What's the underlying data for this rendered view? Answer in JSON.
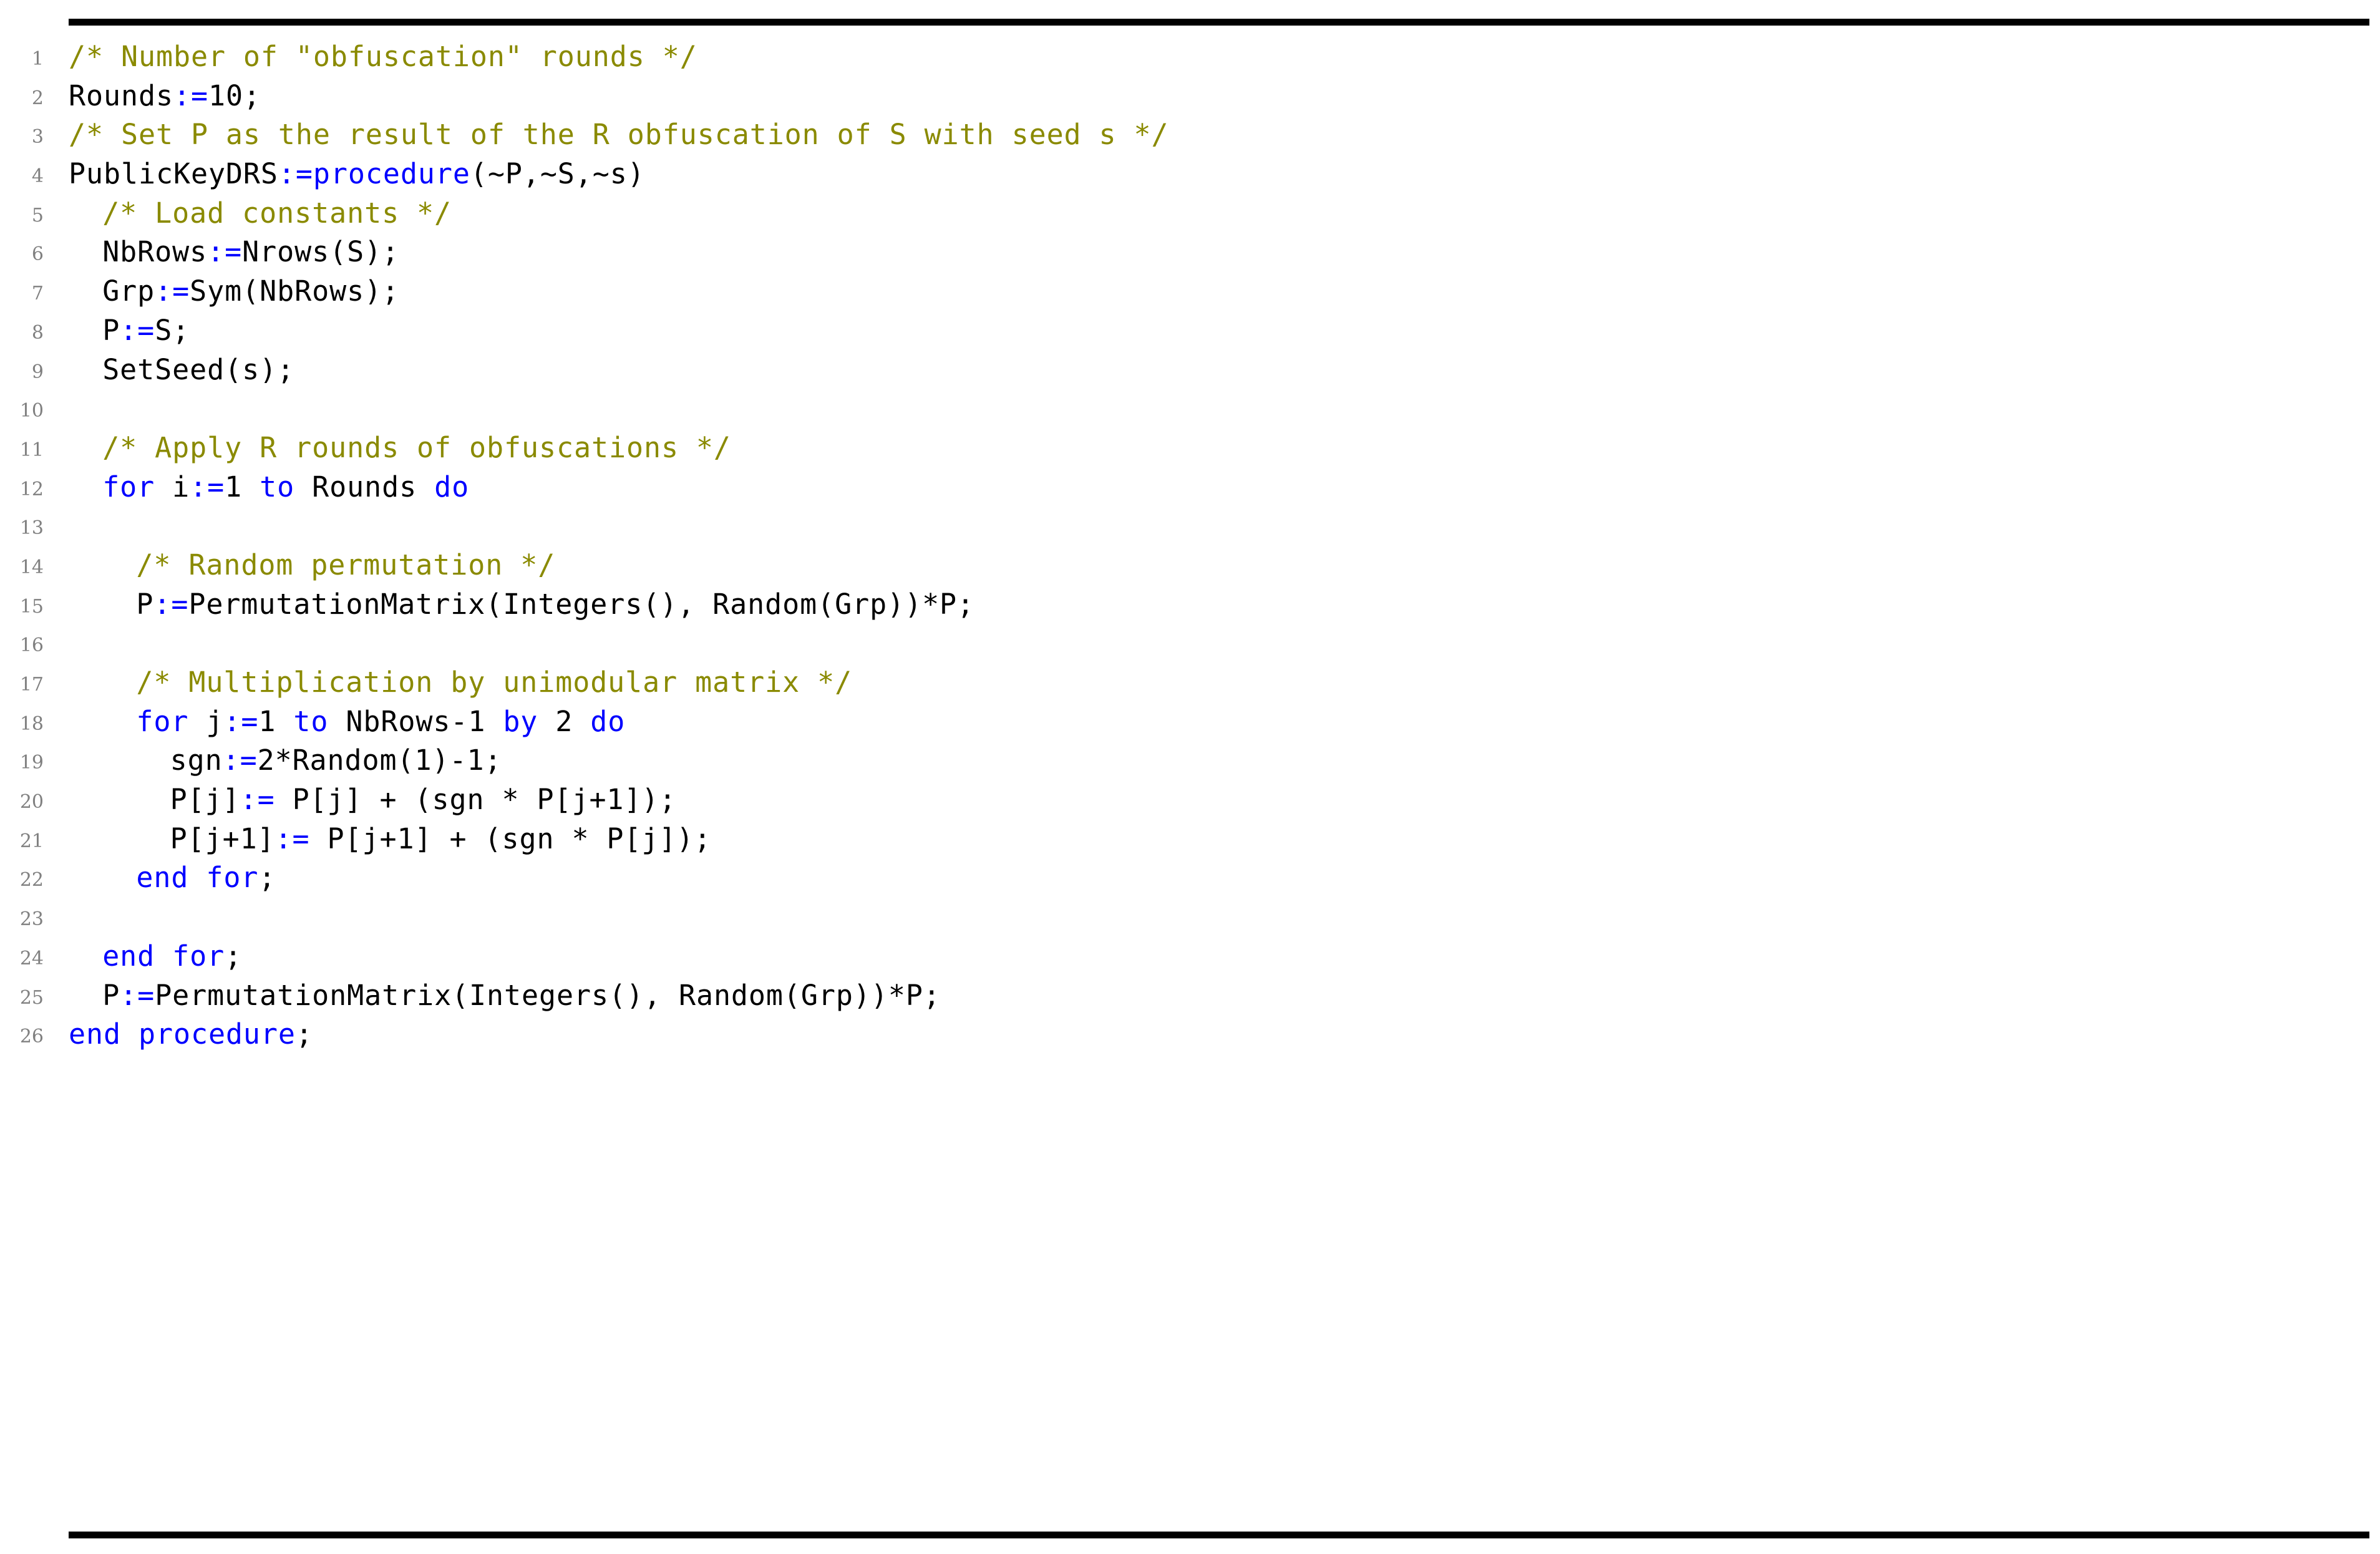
{
  "listing": {
    "language": "Magma",
    "colors": {
      "comment": "#8a8a00",
      "keyword": "#0000ff",
      "plain": "#000000",
      "line_number": "#808080",
      "rule": "#000000",
      "background": "#ffffff"
    },
    "rules": {
      "top": true,
      "bottom": true
    },
    "lines": [
      {
        "number": "1",
        "indent": 0,
        "tokens": [
          {
            "t": "comment",
            "s": "/* Number of \"obfuscation\" rounds */"
          }
        ]
      },
      {
        "number": "2",
        "indent": 0,
        "tokens": [
          {
            "t": "plain",
            "s": "Rounds"
          },
          {
            "t": "keyword",
            "s": ":="
          },
          {
            "t": "plain",
            "s": "10;"
          }
        ]
      },
      {
        "number": "3",
        "indent": 0,
        "tokens": [
          {
            "t": "comment",
            "s": "/* Set P as the result of the R obfuscation of S with seed s */"
          }
        ]
      },
      {
        "number": "4",
        "indent": 0,
        "tokens": [
          {
            "t": "plain",
            "s": "PublicKeyDRS"
          },
          {
            "t": "keyword",
            "s": ":=procedure"
          },
          {
            "t": "plain",
            "s": "(~P,~S,~s)"
          }
        ]
      },
      {
        "number": "5",
        "indent": 2,
        "tokens": [
          {
            "t": "comment",
            "s": "/* Load constants */"
          }
        ]
      },
      {
        "number": "6",
        "indent": 2,
        "tokens": [
          {
            "t": "plain",
            "s": "NbRows"
          },
          {
            "t": "keyword",
            "s": ":="
          },
          {
            "t": "plain",
            "s": "Nrows(S);"
          }
        ]
      },
      {
        "number": "7",
        "indent": 2,
        "tokens": [
          {
            "t": "plain",
            "s": "Grp"
          },
          {
            "t": "keyword",
            "s": ":="
          },
          {
            "t": "plain",
            "s": "Sym(NbRows);"
          }
        ]
      },
      {
        "number": "8",
        "indent": 2,
        "tokens": [
          {
            "t": "plain",
            "s": "P"
          },
          {
            "t": "keyword",
            "s": ":="
          },
          {
            "t": "plain",
            "s": "S;"
          }
        ]
      },
      {
        "number": "9",
        "indent": 2,
        "tokens": [
          {
            "t": "plain",
            "s": "SetSeed(s);"
          }
        ]
      },
      {
        "number": "10",
        "indent": 0,
        "tokens": []
      },
      {
        "number": "11",
        "indent": 2,
        "tokens": [
          {
            "t": "comment",
            "s": "/* Apply R rounds of obfuscations */"
          }
        ]
      },
      {
        "number": "12",
        "indent": 2,
        "tokens": [
          {
            "t": "keyword",
            "s": "for"
          },
          {
            "t": "plain",
            "s": " i"
          },
          {
            "t": "keyword",
            "s": ":="
          },
          {
            "t": "plain",
            "s": "1 "
          },
          {
            "t": "keyword",
            "s": "to"
          },
          {
            "t": "plain",
            "s": " Rounds "
          },
          {
            "t": "keyword",
            "s": "do"
          }
        ]
      },
      {
        "number": "13",
        "indent": 0,
        "tokens": []
      },
      {
        "number": "14",
        "indent": 4,
        "tokens": [
          {
            "t": "comment",
            "s": "/* Random permutation */"
          }
        ]
      },
      {
        "number": "15",
        "indent": 4,
        "tokens": [
          {
            "t": "plain",
            "s": "P"
          },
          {
            "t": "keyword",
            "s": ":="
          },
          {
            "t": "plain",
            "s": "PermutationMatrix(Integers(), Random(Grp))*P;"
          }
        ]
      },
      {
        "number": "16",
        "indent": 0,
        "tokens": []
      },
      {
        "number": "17",
        "indent": 4,
        "tokens": [
          {
            "t": "comment",
            "s": "/* Multiplication by unimodular matrix */"
          }
        ]
      },
      {
        "number": "18",
        "indent": 4,
        "tokens": [
          {
            "t": "keyword",
            "s": "for"
          },
          {
            "t": "plain",
            "s": " j"
          },
          {
            "t": "keyword",
            "s": ":="
          },
          {
            "t": "plain",
            "s": "1 "
          },
          {
            "t": "keyword",
            "s": "to"
          },
          {
            "t": "plain",
            "s": " NbRows-1 "
          },
          {
            "t": "keyword",
            "s": "by"
          },
          {
            "t": "plain",
            "s": " 2 "
          },
          {
            "t": "keyword",
            "s": "do"
          }
        ]
      },
      {
        "number": "19",
        "indent": 6,
        "tokens": [
          {
            "t": "plain",
            "s": "sgn"
          },
          {
            "t": "keyword",
            "s": ":="
          },
          {
            "t": "plain",
            "s": "2*Random(1)-1;"
          }
        ]
      },
      {
        "number": "20",
        "indent": 6,
        "tokens": [
          {
            "t": "plain",
            "s": "P[j]"
          },
          {
            "t": "keyword",
            "s": ":="
          },
          {
            "t": "plain",
            "s": " P[j] + (sgn * P[j+1]);"
          }
        ]
      },
      {
        "number": "21",
        "indent": 6,
        "tokens": [
          {
            "t": "plain",
            "s": "P[j+1]"
          },
          {
            "t": "keyword",
            "s": ":="
          },
          {
            "t": "plain",
            "s": " P[j+1] + (sgn * P[j]);"
          }
        ]
      },
      {
        "number": "22",
        "indent": 4,
        "tokens": [
          {
            "t": "keyword",
            "s": "end for"
          },
          {
            "t": "plain",
            "s": ";"
          }
        ]
      },
      {
        "number": "23",
        "indent": 0,
        "tokens": []
      },
      {
        "number": "24",
        "indent": 2,
        "tokens": [
          {
            "t": "keyword",
            "s": "end for"
          },
          {
            "t": "plain",
            "s": ";"
          }
        ]
      },
      {
        "number": "25",
        "indent": 2,
        "tokens": [
          {
            "t": "plain",
            "s": "P"
          },
          {
            "t": "keyword",
            "s": ":="
          },
          {
            "t": "plain",
            "s": "PermutationMatrix(Integers(), Random(Grp))*P;"
          }
        ]
      },
      {
        "number": "26",
        "indent": 0,
        "tokens": [
          {
            "t": "keyword",
            "s": "end procedure"
          },
          {
            "t": "plain",
            "s": ";"
          }
        ]
      }
    ]
  }
}
